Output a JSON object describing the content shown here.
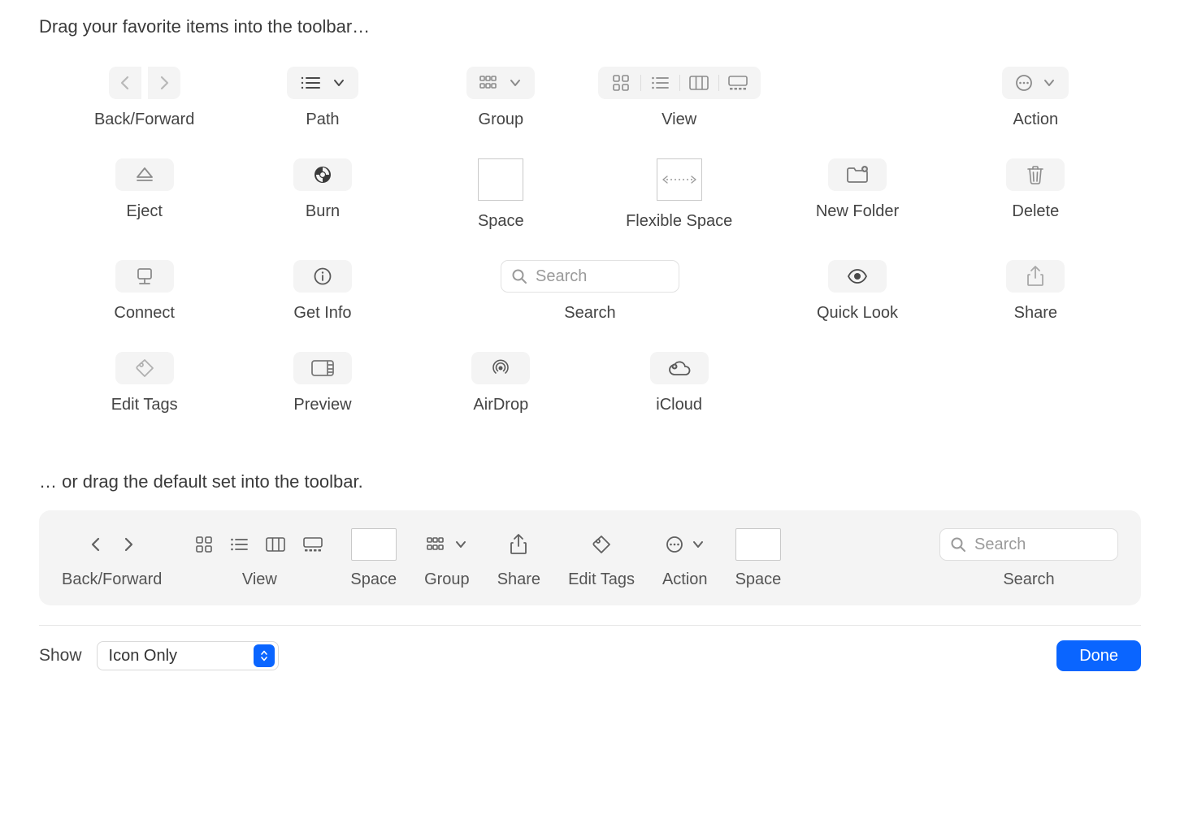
{
  "heading": "Drag your favorite items into the toolbar…",
  "heading2": "… or drag the default set into the toolbar.",
  "items": {
    "back_forward": "Back/Forward",
    "path": "Path",
    "group": "Group",
    "view": "View",
    "action": "Action",
    "eject": "Eject",
    "burn": "Burn",
    "space": "Space",
    "flexible_space": "Flexible Space",
    "new_folder": "New Folder",
    "delete": "Delete",
    "connect": "Connect",
    "get_info": "Get Info",
    "search": "Search",
    "quick_look": "Quick Look",
    "share": "Share",
    "edit_tags": "Edit Tags",
    "preview": "Preview",
    "airdrop": "AirDrop",
    "icloud": "iCloud"
  },
  "search_placeholder": "Search",
  "default_set": {
    "back_forward": "Back/Forward",
    "view": "View",
    "space1": "Space",
    "group": "Group",
    "share": "Share",
    "edit_tags": "Edit Tags",
    "action": "Action",
    "space2": "Space",
    "search": "Search",
    "search_placeholder": "Search"
  },
  "show": {
    "label": "Show",
    "value": "Icon Only"
  },
  "done": "Done"
}
